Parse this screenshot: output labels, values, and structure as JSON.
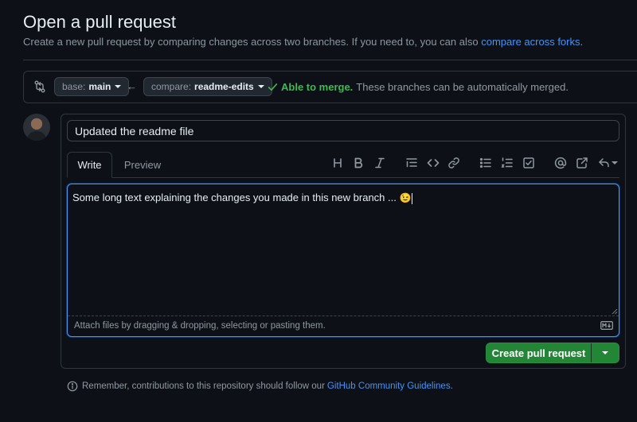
{
  "page": {
    "title": "Open a pull request",
    "subtitle": "Create a new pull request by comparing changes across two branches. If you need to, you can also",
    "subtitle_link": "compare across forks",
    "subtitle_end": "."
  },
  "range": {
    "compare_icon": "git-compare-icon",
    "base_prefix": "base:",
    "base_branch": "main",
    "arrow": "←",
    "compare_prefix": "compare:",
    "compare_branch": "readme-edits",
    "merge_status": "Able to merge.",
    "merge_detail": "These branches can be automatically merged.",
    "status_color": "#3fb950"
  },
  "form": {
    "title_value": "Updated the readme file",
    "tabs": [
      {
        "label": "Write",
        "active": true
      },
      {
        "label": "Preview",
        "active": false
      }
    ],
    "toolbar": [
      "heading-icon",
      "bold-icon",
      "italic-icon",
      "quote-icon",
      "code-icon",
      "link-icon",
      "unordered-list-icon",
      "ordered-list-icon",
      "task-list-icon",
      "mention-icon",
      "cross-reference-icon",
      "reply-icon"
    ],
    "body_text": "Some long text explaining the changes you made in this new branch ... ",
    "body_emoji": "😉",
    "attach_text": "Attach files by dragging & dropping, selecting or pasting them.",
    "markdown_icon": "markdown-icon"
  },
  "actions": {
    "create_label": "Create pull request",
    "accent": "#238636"
  },
  "footer": {
    "text": "Remember, contributions to this repository should follow our",
    "link": "GitHub Community Guidelines",
    "end": "."
  }
}
